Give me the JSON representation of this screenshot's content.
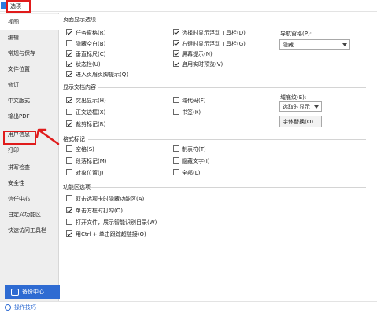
{
  "window": {
    "title": "选项"
  },
  "sidebar": {
    "items": [
      {
        "label": "视图",
        "active": true
      },
      {
        "label": "编辑"
      },
      {
        "label": "常规与保存"
      },
      {
        "label": "文件位置"
      },
      {
        "label": "修订"
      },
      {
        "label": "中文版式"
      },
      {
        "label": "输出PDF"
      },
      {
        "label": "用户信息"
      },
      {
        "label": "打印"
      },
      {
        "label": "拼写检查"
      },
      {
        "label": "安全性"
      },
      {
        "label": "信任中心"
      },
      {
        "label": "自定义功能区"
      },
      {
        "label": "快速访问工具栏"
      }
    ],
    "backup_label": "备份中心"
  },
  "footer": {
    "tips_label": "操作技巧"
  },
  "page_display": {
    "title": "页面显示选项",
    "left": [
      {
        "label": "任务窗格(R)",
        "checked": true
      },
      {
        "label": "隐藏空白(B)",
        "checked": false
      },
      {
        "label": "垂直标尺(C)",
        "checked": true
      },
      {
        "label": "状态栏(U)",
        "checked": true
      },
      {
        "label": "进入页眉页脚提示(Q)",
        "checked": true
      }
    ],
    "right": [
      {
        "label": "选择时显示浮动工具栏(D)",
        "checked": true
      },
      {
        "label": "右键时显示浮动工具栏(G)",
        "checked": true
      },
      {
        "label": "屏幕提示(N)",
        "checked": true
      },
      {
        "label": "启用实时预览(V)",
        "checked": true
      }
    ],
    "nav_pane_label": "导航窗格(P):",
    "nav_pane_value": "隐藏"
  },
  "show_content": {
    "title": "显示文档内容",
    "left": [
      {
        "label": "突出显示(H)",
        "checked": true
      },
      {
        "label": "正文边框(X)",
        "checked": false
      },
      {
        "label": "裁剪标记(R)",
        "checked": true
      }
    ],
    "right": [
      {
        "label": "域代码(F)",
        "checked": false
      },
      {
        "label": "书签(K)",
        "checked": false
      }
    ],
    "field_shading_label": "域底纹(E):",
    "field_shading_value": "选取时显示",
    "font_replace_label": "字体替换(O)..."
  },
  "format_marks": {
    "title": "格式标记",
    "left": [
      {
        "label": "空格(S)",
        "checked": false
      },
      {
        "label": "段落标记(M)",
        "checked": false
      },
      {
        "label": "对象位置(J)",
        "checked": false
      }
    ],
    "right": [
      {
        "label": "制表符(T)",
        "checked": false
      },
      {
        "label": "隐藏文字(I)",
        "checked": false
      },
      {
        "label": "全部(L)",
        "checked": false
      }
    ]
  },
  "ribbon": {
    "title": "功能区选项",
    "items": [
      {
        "label": "双击选项卡时隐藏功能区(A)",
        "checked": false
      },
      {
        "label": "单击方框时打勾(O)",
        "checked": true
      },
      {
        "label": "打开文件，展示智能识别目录(W)",
        "checked": false
      },
      {
        "label": "用Ctrl + 单击跟踪超链接(O)",
        "checked": true
      }
    ]
  },
  "colors": {
    "accent": "#2e6bd2",
    "highlight": "#e01b1b"
  }
}
